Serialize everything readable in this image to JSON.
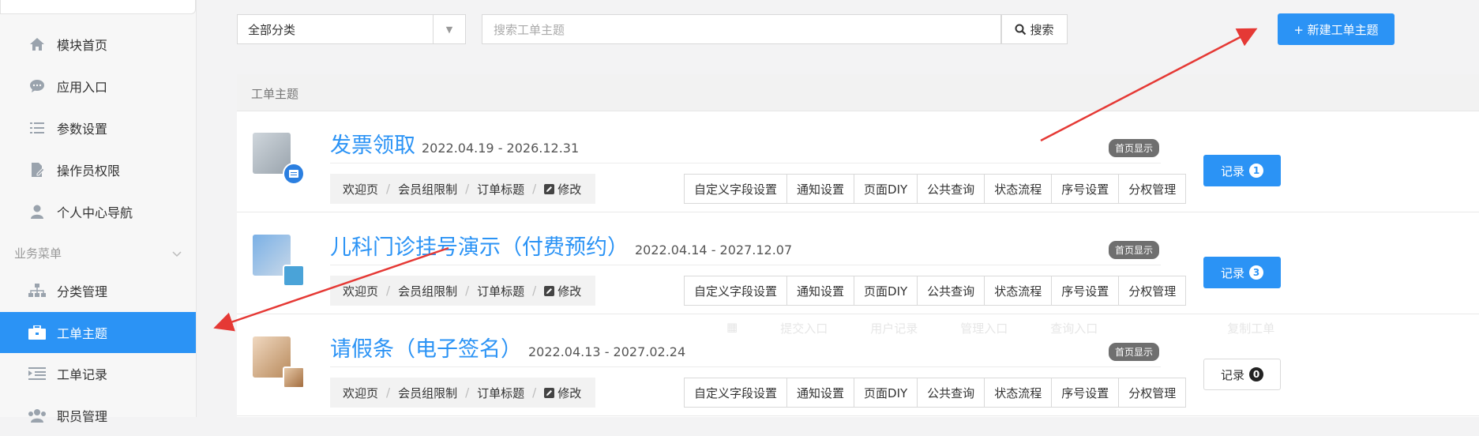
{
  "sidebar": {
    "items": [
      {
        "label": "模块首页",
        "icon": "home-icon"
      },
      {
        "label": "应用入口",
        "icon": "chat-icon"
      },
      {
        "label": "参数设置",
        "icon": "list-icon"
      },
      {
        "label": "操作员权限",
        "icon": "file-edit-icon"
      },
      {
        "label": "个人中心导航",
        "icon": "user-icon"
      }
    ],
    "group": {
      "label": "业务菜单"
    },
    "group_items": [
      {
        "label": "分类管理",
        "icon": "sitemap-icon"
      },
      {
        "label": "工单主题",
        "icon": "briefcase-icon",
        "active": true
      },
      {
        "label": "工单记录",
        "icon": "indent-list-icon"
      },
      {
        "label": "职员管理",
        "icon": "users-icon"
      }
    ]
  },
  "toolbar": {
    "category_value": "全部分类",
    "search_placeholder": "搜索工单主题",
    "search_label": "搜索",
    "new_label": "+ 新建工单主题"
  },
  "table": {
    "header": "工单主题",
    "home_tag": "首页显示",
    "record_label": "记录",
    "crumbs": [
      "欢迎页",
      "会员组限制",
      "订单标题",
      "修改"
    ],
    "actions": [
      "自定义字段设置",
      "通知设置",
      "页面DIY",
      "公共查询",
      "状态流程",
      "序号设置",
      "分权管理"
    ],
    "ghost_actions": [
      "提交入口",
      "用户记录",
      "管理入口",
      "查询入口",
      "复制工单"
    ],
    "rows": [
      {
        "title": "发票领取",
        "date": "2022.04.19 - 2026.12.31",
        "count": "1"
      },
      {
        "title": "儿科门诊挂号演示（付费预约）",
        "date": "2022.04.14 - 2027.12.07",
        "count": "3"
      },
      {
        "title": "请假条（电子签名）",
        "date": "2022.04.13 - 2027.02.24",
        "count": "0"
      }
    ]
  },
  "colors": {
    "accent": "#2b93f5",
    "annotation": "#e53935"
  }
}
